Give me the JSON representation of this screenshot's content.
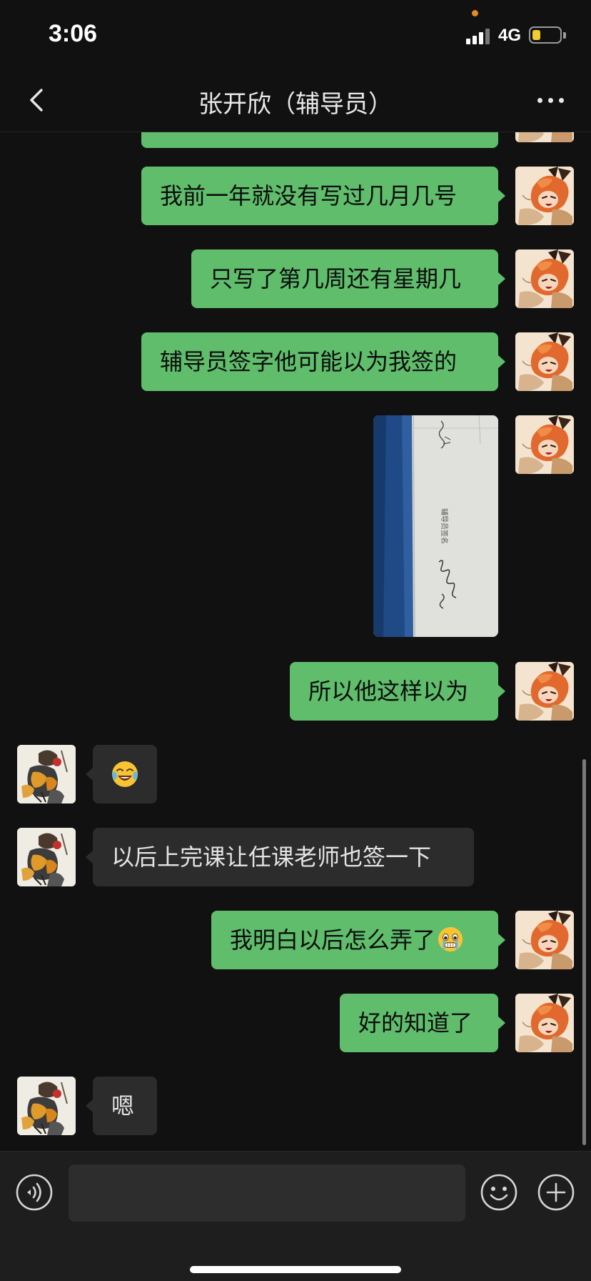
{
  "status_bar": {
    "time": "3:06",
    "network": "4G",
    "battery_level": 0.3
  },
  "nav": {
    "title": "张开欣（辅导员）",
    "back_icon": "chevron-left-icon",
    "more_icon": "more-dots-icon"
  },
  "messages": [
    {
      "direction": "out",
      "type": "text",
      "text": "我前一年就没有写过几月几号"
    },
    {
      "direction": "out",
      "type": "text",
      "text": "只写了第几周还有星期几"
    },
    {
      "direction": "out",
      "type": "text",
      "text": "辅导员签字他可能以为我签的"
    },
    {
      "direction": "out",
      "type": "image",
      "image_text": "辅导员签名"
    },
    {
      "direction": "out",
      "type": "text",
      "text": "所以他这样以为"
    },
    {
      "direction": "in",
      "type": "emoji",
      "emoji": "crying-laughing-emoji"
    },
    {
      "direction": "in",
      "type": "text",
      "text": "以后上完课让任课老师也签一下"
    },
    {
      "direction": "out",
      "type": "text",
      "text": "我明白以后怎么弄了",
      "trailing_emoji": "teary-eyed-emoji"
    },
    {
      "direction": "out",
      "type": "text",
      "text": "好的知道了"
    },
    {
      "direction": "in",
      "type": "text",
      "text": "嗯"
    }
  ],
  "input_bar": {
    "voice_icon": "voice-icon",
    "text_value": "",
    "emoji_icon": "smiley-icon",
    "plus_icon": "plus-icon"
  },
  "colors": {
    "outgoing_bubble": "#5fbd6c",
    "incoming_bubble": "#2c2c2c",
    "background": "#111111"
  }
}
